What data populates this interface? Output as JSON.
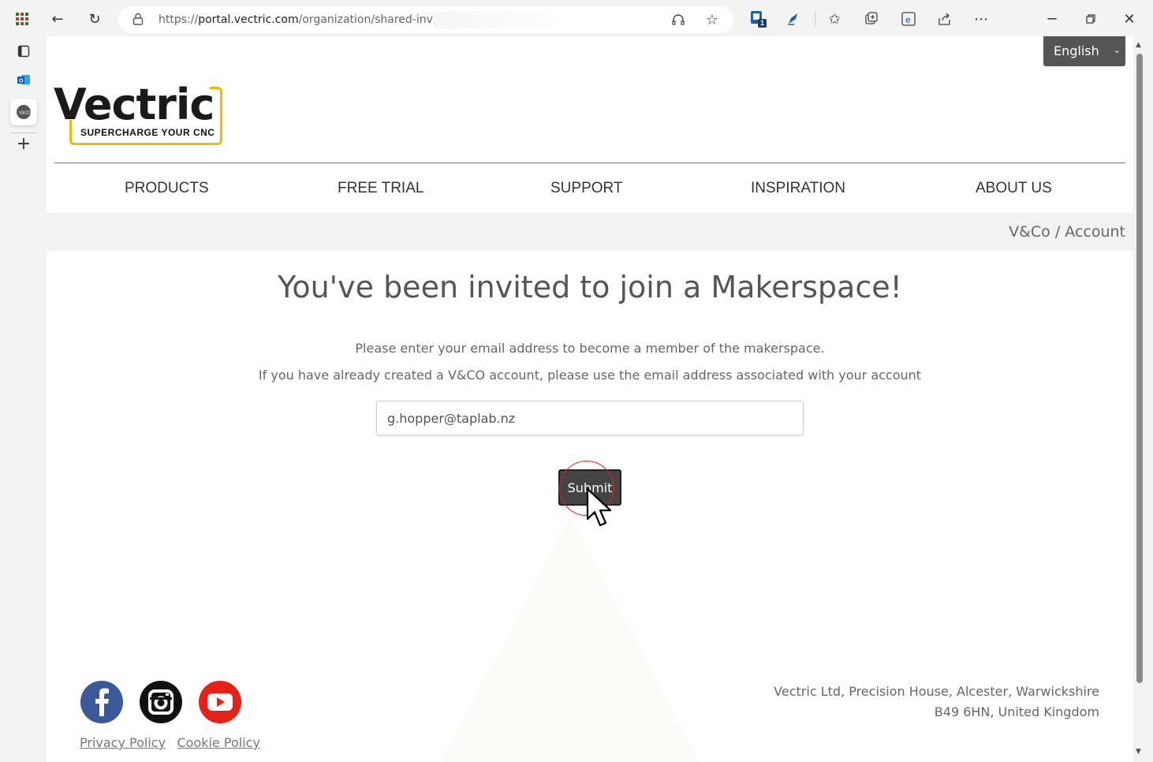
{
  "browser": {
    "url_prefix": "https://",
    "url_host": "portal.vectric.com",
    "url_path": "/organization/shared-invite/",
    "badge_count": "1"
  },
  "site": {
    "language": "English",
    "logo_word": "Vectric",
    "logo_tagline": "SUPERCHARGE YOUR CNC",
    "brand_color": "#f5b800",
    "nav": [
      "PRODUCTS",
      "FREE TRIAL",
      "SUPPORT",
      "INSPIRATION",
      "ABOUT US"
    ],
    "breadcrumb": "V&Co / Account"
  },
  "invite": {
    "title": "You've been invited to join a Makerspace!",
    "instruction": "Please enter your email address to become a member of the makerspace.",
    "note": "If you have already created a V&CO account, please use the email address associated with your account",
    "email_value": "g.hopper@taplab.nz",
    "submit_label": "Submit"
  },
  "footer": {
    "address_line1": "Vectric Ltd, Precision House, Alcester, Warwickshire",
    "address_line2": "B49 6HN, United Kingdom",
    "privacy_label": "Privacy Policy",
    "cookie_label": "Cookie Policy",
    "social": [
      {
        "icon": "facebook-icon",
        "color": "#3b5998"
      },
      {
        "icon": "instagram-icon",
        "color": "#111111"
      },
      {
        "icon": "youtube-icon",
        "color": "#e62117"
      }
    ]
  }
}
